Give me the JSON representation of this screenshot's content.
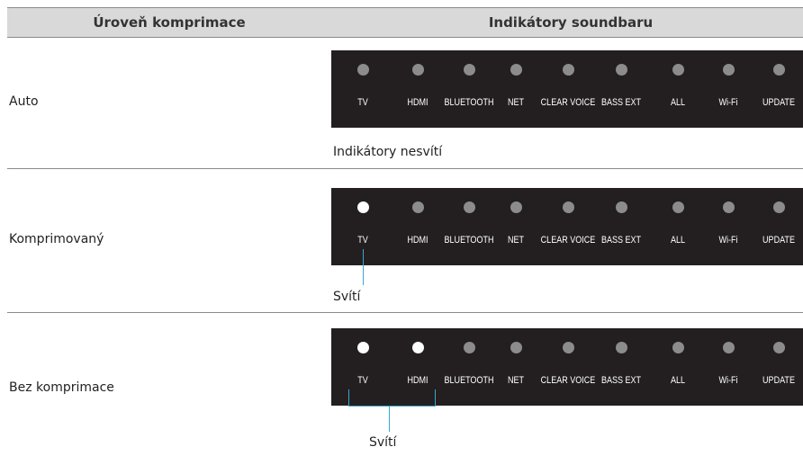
{
  "header": {
    "col1": "Úroveň komprimace",
    "col2": "Indikátory soundbaru"
  },
  "indicators": [
    "TV",
    "HDMI",
    "BLUETOOTH",
    "NET",
    "CLEAR VOICE",
    "BASS EXT",
    "ALL",
    "Wi-Fi",
    "UPDATE"
  ],
  "rows": [
    {
      "level": "Auto",
      "lit": [],
      "note": "Indikátory nesvítí"
    },
    {
      "level": "Komprimovaný",
      "lit": [
        "TV"
      ],
      "note": "Svítí"
    },
    {
      "level": "Bez komprimace",
      "lit": [
        "TV",
        "HDMI"
      ],
      "note": "Svítí"
    }
  ],
  "colors": {
    "led_off": "#8c8c8c",
    "led_on": "#ffffff",
    "panel": "#231f20",
    "callout": "#3aa6d0"
  }
}
